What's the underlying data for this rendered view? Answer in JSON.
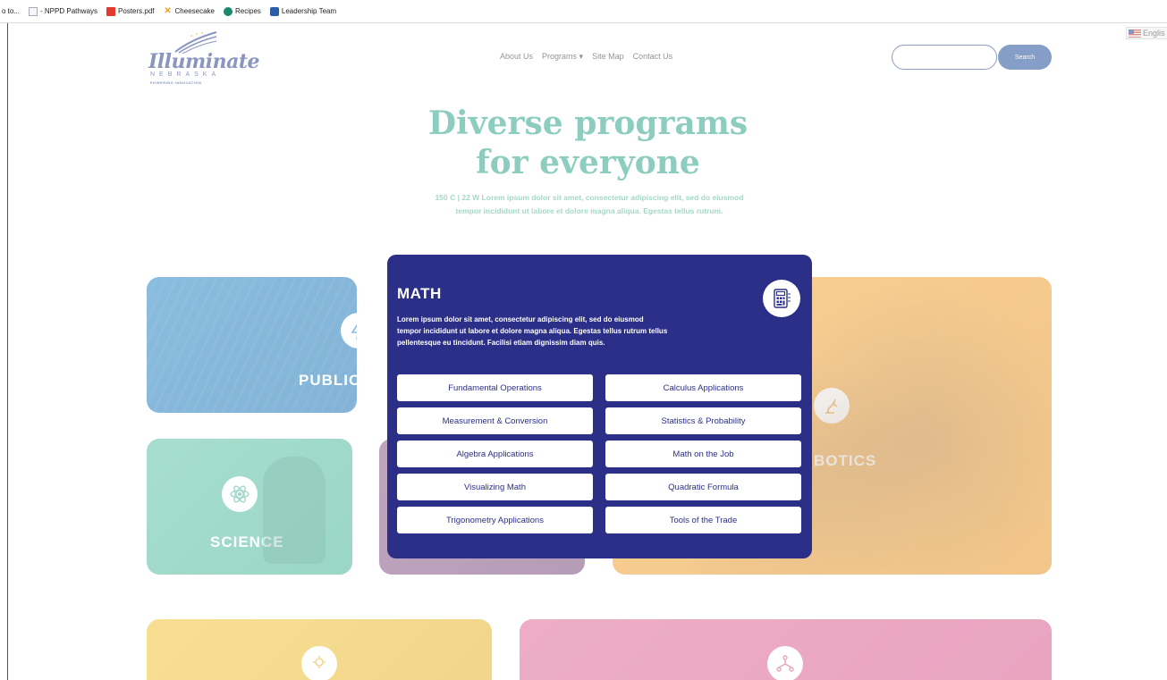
{
  "bookmarks": [
    {
      "label": "o to...",
      "icon": "page-icon"
    },
    {
      "label": "- NPPD Pathways",
      "icon": "page-icon"
    },
    {
      "label": "Posters.pdf",
      "icon": "pdf-icon"
    },
    {
      "label": "Cheesecake",
      "icon": "cheesecake-icon"
    },
    {
      "label": "Recipes",
      "icon": "recipes-icon"
    },
    {
      "label": "Leadership Team",
      "icon": "team-icon"
    }
  ],
  "header": {
    "logo_main": "Illuminate",
    "logo_sub": "NEBRASKA",
    "logo_tag": "POWERING INNOVATION",
    "nav": [
      "About Us",
      "Programs ▾",
      "Site Map",
      "Contact Us"
    ],
    "search_placeholder": "",
    "search_label": "Search",
    "language": "Englis"
  },
  "hero": {
    "title_line1": "Diverse programs",
    "title_line2": "for everyone",
    "subtitle_line1": "150 C | 22 W Lorem ipsum dolor sit amet, consectetur adipiscing elit, sed do eiusmod",
    "subtitle_line2": "tempor incididunt ut labore et dolore magna aliqua. Egestas tellus rutrum."
  },
  "cards": {
    "public": "PUBLIC PC",
    "robotics": "BOTICS",
    "science": "SCIENCE"
  },
  "modal": {
    "title": "MATH",
    "description_line1": "Lorem ipsum dolor sit amet, consectetur adipiscing elit, sed do eiusmod",
    "description_line2": "tempor incididunt ut labore et dolore magna aliqua. Egestas tellus rutrum tellus",
    "description_line3": "pellentesque eu tincidunt. Facilisi etiam dignissim diam quis.",
    "topics": [
      "Fundamental Operations",
      "Calculus Applications",
      "Measurement & Conversion",
      "Statistics & Probability",
      "Algebra Applications",
      "Math on the Job",
      "Visualizing Math",
      "Quadratic Formula",
      "Trigonometry Applications",
      "Tools of the Trade"
    ]
  },
  "colors": {
    "modal_bg": "#2b2f87",
    "hero_green": "#2fa58a",
    "brand_blue": "#1f4f99"
  }
}
